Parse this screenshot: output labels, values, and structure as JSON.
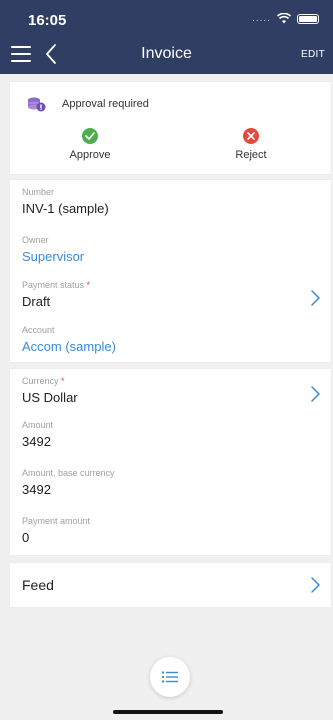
{
  "status_bar": {
    "time": "16:05",
    "signal": "....."
  },
  "nav": {
    "title": "Invoice",
    "edit_label": "EDIT"
  },
  "approval": {
    "title": "Approval required",
    "approve_label": "Approve",
    "reject_label": "Reject",
    "approve_color": "#4cae4c",
    "reject_color": "#e24a3b",
    "icon_color": "#8e6cc7"
  },
  "fields": {
    "number": {
      "label": "Number",
      "value": "INV-1 (sample)"
    },
    "owner": {
      "label": "Owner",
      "value": "Supervisor"
    },
    "payment_status": {
      "label": "Payment status",
      "required": "*",
      "value": "Draft"
    },
    "account": {
      "label": "Account",
      "value": "Accom (sample)"
    },
    "currency": {
      "label": "Currency",
      "required": "*",
      "value": "US Dollar"
    },
    "amount": {
      "label": "Amount",
      "value": "3492"
    },
    "amount_base": {
      "label": "Amount, base currency",
      "value": "3492"
    },
    "payment_amount": {
      "label": "Payment amount",
      "value": "0"
    }
  },
  "feed": {
    "label": "Feed"
  },
  "colors": {
    "header": "#2f3e62",
    "link": "#3a8bd8",
    "chevron": "#3a8bd8"
  }
}
